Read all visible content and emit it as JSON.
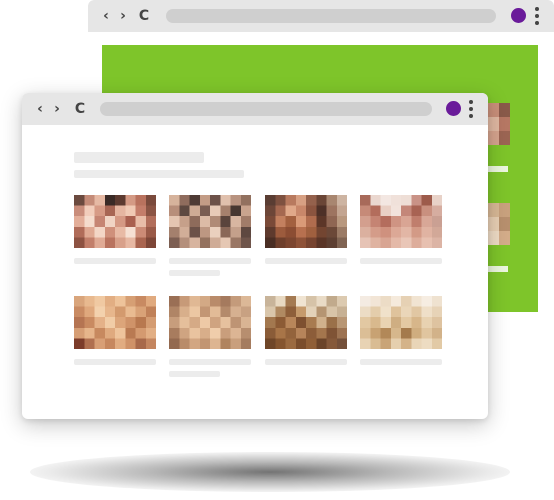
{
  "colors": {
    "accent_green": "#7ec52a",
    "profile_purple": "#6a1b9a",
    "toolbar_gray": "#e6e6e6",
    "address_gray": "#cfcfcf",
    "skeleton_gray": "#ececec"
  },
  "back_window": {
    "controls": {
      "back_glyph": "‹",
      "forward_glyph": "›",
      "reload_glyph": "C"
    },
    "icons": [
      "back-arrow-icon",
      "forward-arrow-icon",
      "reload-icon",
      "profile-avatar",
      "kebab-menu-icon"
    ]
  },
  "front_window": {
    "controls": {
      "back_glyph": "‹",
      "forward_glyph": "›",
      "reload_glyph": "C"
    },
    "icons": [
      "back-arrow-icon",
      "forward-arrow-icon",
      "reload-icon",
      "profile-avatar",
      "kebab-menu-icon"
    ],
    "gallery": {
      "rows": 2,
      "columns": 4,
      "thumbnail_style": "pixelated"
    }
  }
}
